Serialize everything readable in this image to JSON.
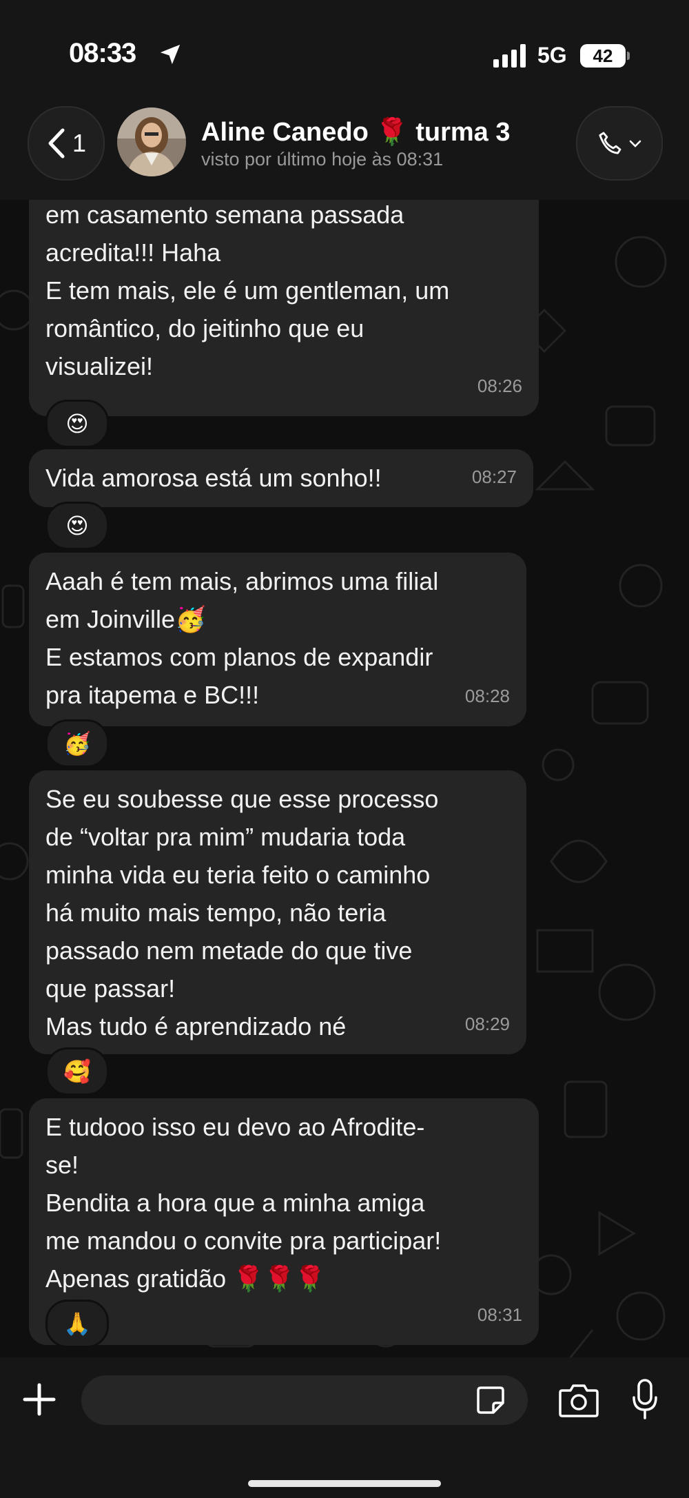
{
  "status_bar": {
    "time": "08:33",
    "network": "5G",
    "battery": "42",
    "icons": [
      "location-arrow-icon",
      "signal-icon"
    ]
  },
  "header": {
    "back_count": "1",
    "contact_name": "Aline Canedo 🌹 turma 3",
    "last_seen": "visto por último hoje às 08:31",
    "icons": [
      "chevron-left-icon",
      "phone-icon",
      "chevron-down-icon"
    ]
  },
  "messages": [
    {
      "text": "em casamento semana passada\nacredita!!! Haha\nE tem mais, ele é um gentleman, um\nromântico, do jeitinho que eu\nvisualizei!",
      "time": "08:26",
      "reaction": "😍"
    },
    {
      "text": "Vida amorosa está um sonho!!",
      "time": "08:27",
      "reaction": "😍"
    },
    {
      "text": "Aaah é tem mais, abrimos uma filial\nem Joinville🥳\nE estamos com planos de expandir\npra itapema e BC!!!",
      "time": "08:28",
      "reaction": "🥳"
    },
    {
      "text": "Se eu soubesse que esse processo\nde “voltar pra mim” mudaria toda\nminha vida eu teria feito o caminho\nhá muito mais tempo, não teria\npassado nem metade do que tive\nque passar!\nMas tudo é aprendizado né",
      "time": "08:29",
      "reaction": "🥰"
    },
    {
      "text": "E tudooo isso eu devo ao Afrodite-\nse!\nBendita a hora que a minha amiga\nme mandou o convite pra participar!\nApenas gratidão 🌹🌹🌹",
      "time": "08:31",
      "reaction": "🙏"
    }
  ],
  "composer": {
    "placeholder": "",
    "icons": [
      "plus-icon",
      "sticker-icon",
      "camera-icon",
      "microphone-icon"
    ]
  },
  "colors": {
    "background": "#0b0b0b",
    "bubble": "#252525",
    "secondary_text": "#9b9b9b"
  }
}
